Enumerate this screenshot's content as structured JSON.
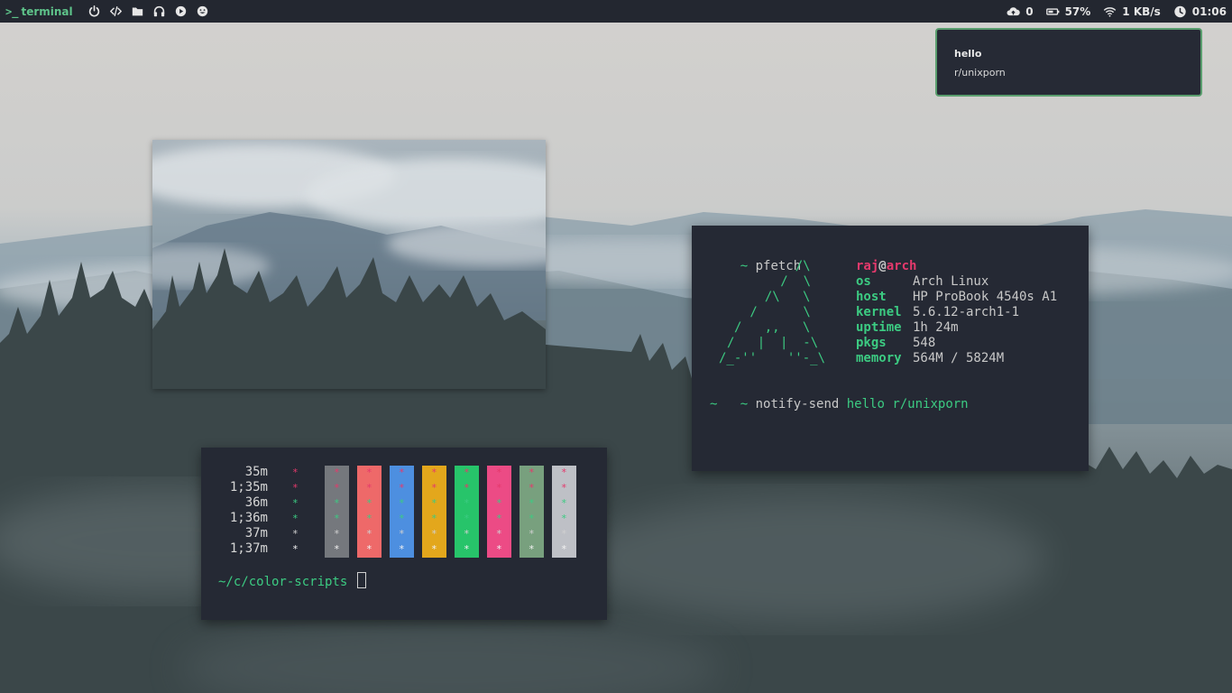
{
  "topbar": {
    "workspace_prompt": ">_",
    "workspace_label": "terminal",
    "left_icons": [
      "power-icon",
      "code-icon",
      "folder-icon",
      "headphones-icon",
      "play-icon",
      "smiley-icon"
    ],
    "upload_count": "0",
    "battery": "57%",
    "network_speed": "1 KB/s",
    "clock": "01:06"
  },
  "notification": {
    "title": "hello",
    "body": "r/unixporn"
  },
  "pfetch_terminal": {
    "command_prompt": "~",
    "command": "pfetch",
    "ascii_art": [
      "    /\\",
      "   /  \\",
      "  /\\   \\",
      " /      \\",
      "/   ,,   \\",
      "/   |  |  -\\",
      "/_-''    ''-_\\"
    ],
    "user": "raj",
    "at": "@",
    "host_name": "arch",
    "info": [
      {
        "key": "os",
        "value": "Arch Linux"
      },
      {
        "key": "host",
        "value": "HP ProBook 4540s A1"
      },
      {
        "key": "kernel",
        "value": "5.6.12-arch1-1"
      },
      {
        "key": "uptime",
        "value": "1h 24m"
      },
      {
        "key": "pkgs",
        "value": "548"
      },
      {
        "key": "memory",
        "value": "564M / 5824M"
      }
    ],
    "second_command": "notify-send",
    "second_args": "hello r/unixporn",
    "last_prompt": "~"
  },
  "colors_terminal": {
    "row_labels": [
      "35m",
      "1;35m",
      "36m",
      "1;36m",
      "37m",
      "1;37m"
    ],
    "star": "*",
    "swatch_colors": [
      "#75787d",
      "#ee6969",
      "#4d8fe0",
      "#e3a71c",
      "#27c46a",
      "#ec4b85",
      "#78a07e",
      "#bec0c6"
    ],
    "row_star_colors": [
      "#e4396c",
      "#e4396c",
      "#3ccb82",
      "#3ccb82",
      "#d0d0d0",
      "#f2f2f2"
    ],
    "prompt": "~/c/color-scripts"
  },
  "colors": {
    "topbar_bg": "#232730",
    "terminal_bg": "#252934",
    "accent_green": "#3ccb82",
    "accent_pink": "#e4396c"
  }
}
